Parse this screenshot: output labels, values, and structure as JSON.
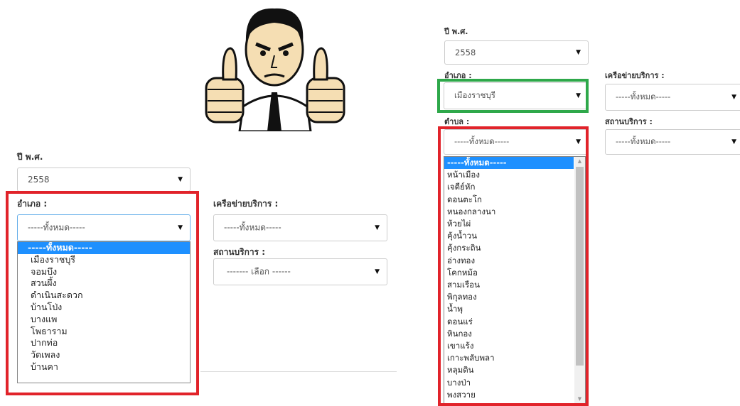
{
  "left": {
    "year_label": "ปี พ.ศ.",
    "year_value": "2558",
    "amphoe_label": "อำเภอ :",
    "amphoe_value": "-----ทั้งหมด-----",
    "network_label": "เครือข่ายบริการ :",
    "network_value": "-----ทั้งหมด-----",
    "service_label": "สถานบริการ :",
    "service_value": "------- เลือก ------",
    "amphoe_options": [
      "-----ทั้งหมด-----",
      "เมืองราชบุรี",
      "จอมบึง",
      "สวนผึ้ง",
      "ดำเนินสะดวก",
      "บ้านโป่ง",
      "บางแพ",
      "โพธาราม",
      "ปากท่อ",
      "วัดเพลง",
      "บ้านคา"
    ]
  },
  "right": {
    "year_label": "ปี พ.ศ.",
    "year_value": "2558",
    "amphoe_label": "อำเภอ :",
    "amphoe_value": "เมืองราชบุรี",
    "network_label": "เครือข่ายบริการ :",
    "network_value": "-----ทั้งหมด-----",
    "tambon_label": "ตำบล :",
    "tambon_value": "-----ทั้งหมด-----",
    "service_label": "สถานบริการ :",
    "service_value": "-----ทั้งหมด-----",
    "tambon_options": [
      "-----ทั้งหมด-----",
      "หน้าเมือง",
      "เจดีย์หัก",
      "ดอนตะโก",
      "หนองกลางนา",
      "ห้วยไผ่",
      "คุ้งน้ำวน",
      "คุ้งกระถิน",
      "อ่างทอง",
      "โคกหม้อ",
      "สามเรือน",
      "พิกุลทอง",
      "น้ำพุ",
      "ดอนแร่",
      "หินกอง",
      "เขาแร้ง",
      "เกาะพลับพลา",
      "หลุมดิน",
      "บางป่า",
      "พงสวาย"
    ]
  },
  "colors": {
    "highlight_red": "#e1232a",
    "highlight_green": "#2ea84a",
    "selected_option": "#1e90ff"
  },
  "icons": [
    "thumbs-up-man-illustration",
    "dropdown-caret-icon"
  ]
}
